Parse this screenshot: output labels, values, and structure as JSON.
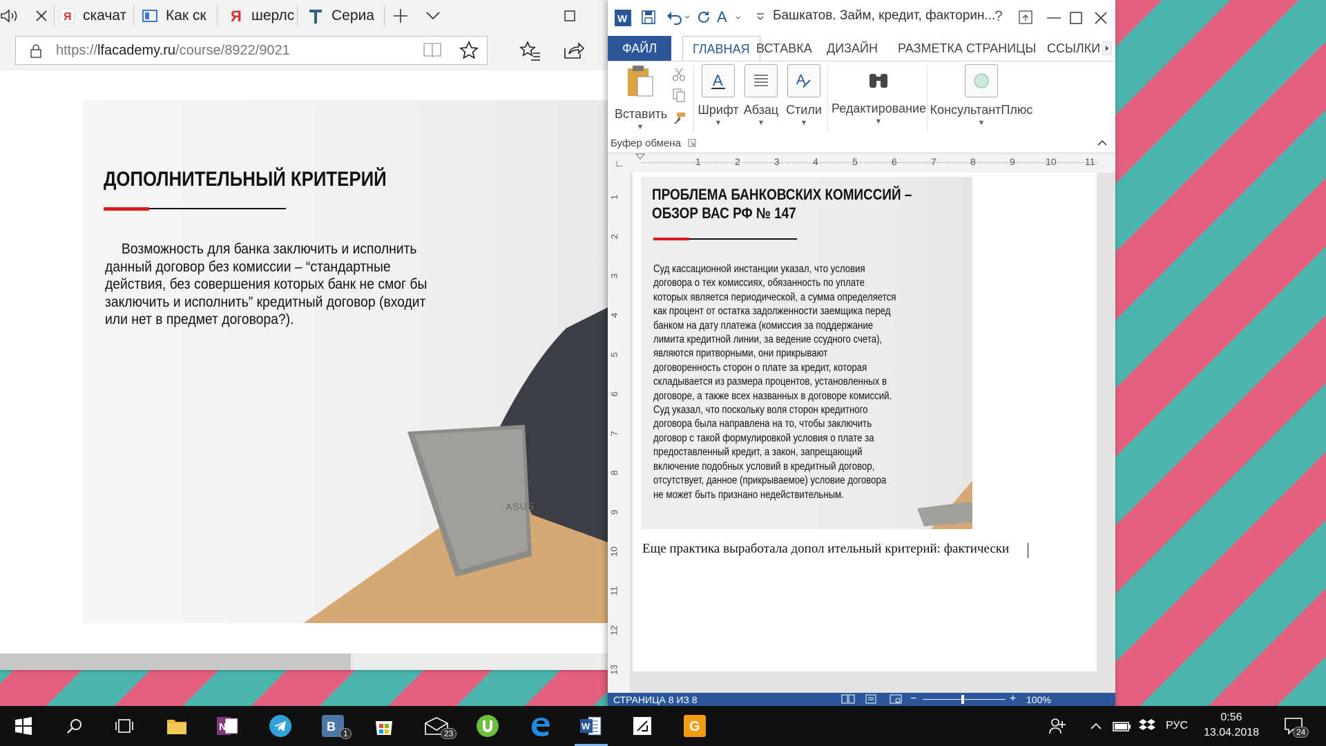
{
  "browser": {
    "tabs": [
      {
        "label": "скачат",
        "icon": "yandex-icon"
      },
      {
        "label": "Как ск",
        "icon": "reader-icon"
      },
      {
        "label": "шерлс",
        "icon": "yandex-icon"
      },
      {
        "label": "Сериа",
        "icon": "t-logo-icon"
      }
    ],
    "url_prefix": "https://",
    "url_domain": "lfacademy.ru",
    "url_path": "/course/8922/9021"
  },
  "slide": {
    "title": "ДОПОЛНИТЕЛЬНЫЙ КРИТЕРИЙ",
    "body": "Возможность для банка заключить и исполнить данный договор без комиссии – “стандартные действия, без совершения которых банк не смог бы заключить и исполнить” кредитный договор (входит или нет в предмет договора?).",
    "laptop_brand": "ASUS"
  },
  "word": {
    "title": "Башкатов. Займ, кредит, факторин...",
    "help": "?",
    "ribbon_tabs": [
      "ФАЙЛ",
      "ГЛАВНАЯ",
      "ВСТАВКА",
      "ДИЗАЙН",
      "РАЗМЕТКА СТРАНИЦЫ",
      "ССЫЛКИ"
    ],
    "groups": {
      "paste": "Вставить",
      "font": "Шрифт",
      "paragraph": "Абзац",
      "styles": "Стили",
      "editing": "Редактирование",
      "consultant": "КонсультантПлюс"
    },
    "clipboard_group": "Буфер обмена",
    "ruler_numbers": [
      "1",
      "2",
      "3",
      "4",
      "5",
      "6",
      "7",
      "8",
      "9",
      "10",
      "11"
    ],
    "vruler_numbers": [
      "1",
      "2",
      "3",
      "4",
      "5",
      "6",
      "7",
      "8",
      "9",
      "10",
      "11",
      "12",
      "13"
    ],
    "image_title": "ПРОБЛЕМА БАНКОВСКИХ КОМИССИЙ – ОБЗОР ВАС РФ № 147",
    "image_body": "Суд кассационной инстанции указал, что условия договора о тех комиссиях, обязанность по уплате которых является периодической, а сумма определяется как процент от остатка задолженности заемщика перед банком на дату платежа (комиссия за поддержание лимита кредитной линии, за ведение ссудного счета), являются притворными, они прикрывают договоренность сторон о плате за кредит, которая складывается из размера процентов, установленных в договоре, а также всех названных в договоре комиссий. Суд указал, что поскольку воля сторон кредитного договора была направлена на то, чтобы заключить договор с такой формулировкой условия о плате за предоставленный кредит, а закон, запрещающий включение подобных условий в кредитный договор, отсутствует, данное (прикрываемое) условие договора не может быть признано недействительным.",
    "doc_text": "Еще практика выработала допол ительный критерий: фактически",
    "status_page": "СТРАНИЦА 8 ИЗ 8",
    "zoom": "100%"
  },
  "taskbar": {
    "lang": "РУС",
    "time": "0:56",
    "date": "13.04.2018",
    "vk_badge": "1",
    "mail_badge": "23",
    "notif_badge": "24"
  },
  "colors": {
    "word_blue": "#2b579a",
    "accent_red": "#d71920",
    "taskbar": "#101010"
  }
}
